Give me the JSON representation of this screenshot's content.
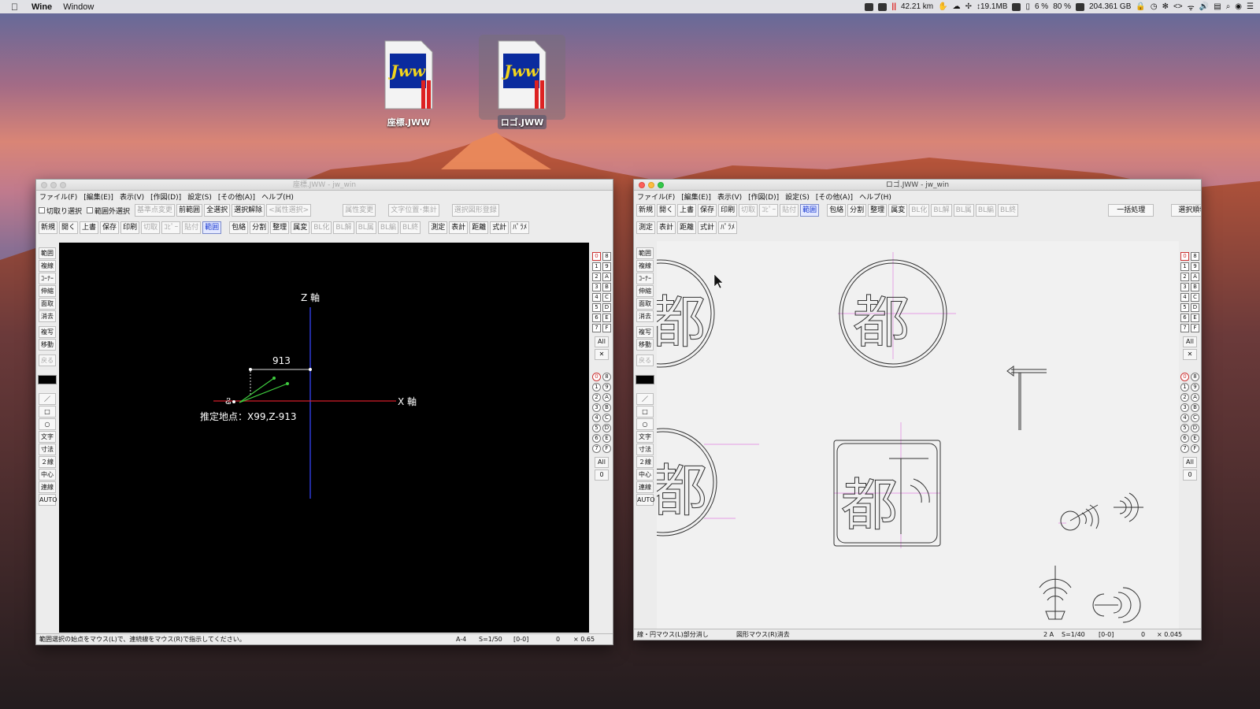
{
  "menubar": {
    "app": "Wine",
    "window_menu": "Window",
    "distance": "42.21 km",
    "network": "↕19.1MB",
    "cpu": "6 %",
    "battery": "80 %",
    "disk": "204.361 GB"
  },
  "desktop": {
    "icons": [
      {
        "label": "座標.JWW",
        "logo": "Jww"
      },
      {
        "label": "ロゴ.JWW",
        "logo": "Jww"
      }
    ]
  },
  "left_window": {
    "title": "座標.JWW - jw_win",
    "menus": [
      "ファイル(F)",
      "[編集(E)]",
      "表示(V)",
      "[作図(D)]",
      "設定(S)",
      "[その他(A)]",
      "ヘルプ(H)"
    ],
    "row1": {
      "check1": "切取り選択",
      "check2": "範囲外選択",
      "buttons": [
        "基準点変更",
        "前範囲",
        "全選択",
        "選択解除",
        "<属性選択>",
        "属性変更",
        "文字位置･集計",
        "選択図形登録"
      ]
    },
    "row2": [
      "新規",
      "開く",
      "上書",
      "保存",
      "印刷",
      "切取",
      "ｺﾋﾟｰ",
      "貼付",
      "範囲",
      "包絡",
      "分割",
      "整理",
      "属変",
      "BL化",
      "BL解",
      "BL属",
      "BL編",
      "BL終",
      "測定",
      "表計",
      "距離",
      "式計",
      "ﾊﾟﾗﾒ"
    ],
    "left_tools": [
      "範囲",
      "複線",
      "ｺｰﾅｰ",
      "伸縮",
      "面取",
      "消去",
      "複写",
      "移動",
      "戻る",
      "／",
      "□",
      "○",
      "文字",
      "寸法",
      "２線",
      "中心線",
      "連線",
      "AUTO"
    ],
    "layer_group": [
      "0",
      "1",
      "2",
      "3",
      "4",
      "5",
      "6",
      "7"
    ],
    "layer_letters": [
      "8",
      "9",
      "A",
      "B",
      "C",
      "D",
      "E",
      "F"
    ],
    "all_label": "All",
    "zero_label": "0",
    "canvas": {
      "z_axis_label": "Z 軸",
      "x_axis_label": "X 軸",
      "dimension": "913",
      "point_label": "推定地点：X99,Z-913"
    },
    "status": {
      "message": "範囲選択の始点をマウス(L)で、連続線をマウス(R)で指示してください。",
      "paper": "A-4",
      "scale": "S=1/50",
      "layer": "[0-0]",
      "angle": "0",
      "zoom": "× 0.65"
    }
  },
  "right_window": {
    "title": "ロゴ.JWW - jw_win",
    "menus": [
      "ファイル(F)",
      "[編集(E)]",
      "表示(V)",
      "[作図(D)]",
      "設定(S)",
      "[その他(A)]",
      "ヘルプ(H)"
    ],
    "row1": [
      "新規",
      "開く",
      "上書",
      "保存",
      "印刷",
      "切取",
      "ｺﾋﾟｰ",
      "貼付",
      "範囲",
      "包絡",
      "分割",
      "整理",
      "属変",
      "BL化",
      "BL解",
      "BL属",
      "BL編",
      "BL終"
    ],
    "batch_button": "一括処理",
    "toggle_button": "選択順切替",
    "row2": [
      "測定",
      "表計",
      "距離",
      "式計",
      "ﾊﾟﾗﾒ"
    ],
    "left_tools": [
      "範囲",
      "複線",
      "ｺｰﾅｰ",
      "伸縮",
      "面取",
      "消去",
      "複写",
      "移動",
      "戻る",
      "／",
      "□",
      "○",
      "文字",
      "寸法",
      "２線",
      "中心線",
      "連線",
      "AUTO"
    ],
    "logo_char": "都",
    "status": {
      "message1": "線・円マウス(L)部分消し",
      "message2": "図形マウス(R)消去",
      "paper": "2 A",
      "scale": "S=1/40",
      "layer": "[0-0]",
      "angle": "0",
      "zoom": "× 0.045"
    }
  }
}
